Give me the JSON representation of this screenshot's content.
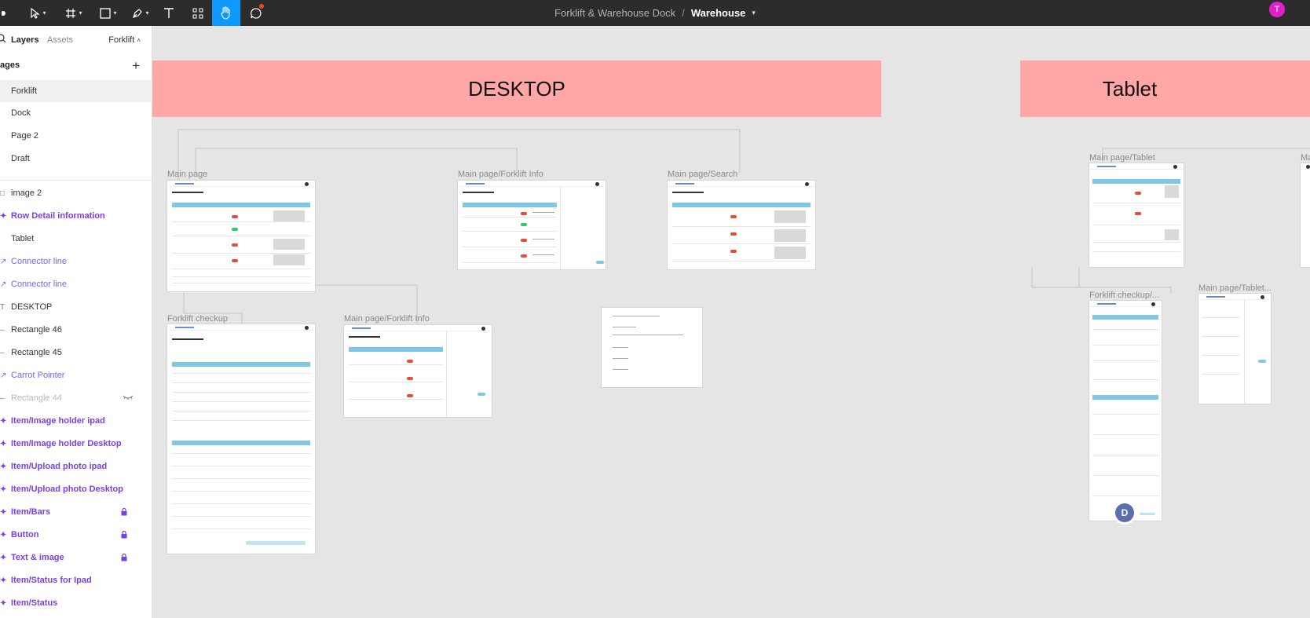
{
  "toolbar": {
    "menu_icon": "figma-menu-icon",
    "tools": [
      "move-tool",
      "frame-tool",
      "shape-tool",
      "pen-tool",
      "text-tool",
      "resources-tool",
      "hand-tool",
      "comment-tool"
    ],
    "active_tool": "hand-tool",
    "accent": "#0d99ff"
  },
  "title": {
    "file": "Forklift & Warehouse Dock",
    "separator": "/",
    "page": "Warehouse"
  },
  "user": {
    "initial": "T",
    "color": "#e020c8"
  },
  "panel": {
    "tabs": {
      "layers": "Layers",
      "assets": "Assets",
      "page": "Forklift"
    },
    "pages_header": "ages",
    "add_page": "+",
    "pages": [
      "Forklift",
      "Dock",
      "Page 2",
      "Draft"
    ],
    "selected_page": "Forklift",
    "layers": [
      {
        "name": "image 2",
        "kind": "image"
      },
      {
        "name": "Row Detail information",
        "kind": "component"
      },
      {
        "name": "Tablet",
        "kind": "text"
      },
      {
        "name": "Connector line",
        "kind": "connector"
      },
      {
        "name": "Connector line",
        "kind": "connector"
      },
      {
        "name": "DESKTOP",
        "kind": "text"
      },
      {
        "name": "Rectangle 46",
        "kind": "rect"
      },
      {
        "name": "Rectangle 45",
        "kind": "rect"
      },
      {
        "name": "Carrot Pointer",
        "kind": "connector"
      },
      {
        "name": "Rectangle 44",
        "kind": "hidden"
      },
      {
        "name": "Item/Image holder ipad",
        "kind": "component"
      },
      {
        "name": "Item/Image holder Desktop",
        "kind": "component"
      },
      {
        "name": "Item/Upload photo ipad",
        "kind": "component"
      },
      {
        "name": "Item/Upload photo Desktop",
        "kind": "component"
      },
      {
        "name": "Item/Bars",
        "kind": "component",
        "locked": true
      },
      {
        "name": "Button",
        "kind": "component",
        "locked": true
      },
      {
        "name": "Text & image",
        "kind": "component",
        "locked": true
      },
      {
        "name": "Item/Status for Ipad",
        "kind": "component"
      },
      {
        "name": "Item/Status",
        "kind": "component"
      }
    ]
  },
  "canvas": {
    "background": "#e5e5e5",
    "sections": [
      {
        "label": "DESKTOP",
        "color": "#ffa6a6"
      },
      {
        "label": "Tablet",
        "color": "#ffa6a6"
      }
    ],
    "frames": [
      {
        "label": "Main page"
      },
      {
        "label": "Main page/Forklift Info"
      },
      {
        "label": "Main page/Search"
      },
      {
        "label": "Forklift checkup"
      },
      {
        "label": "Main page/Forklift Info"
      },
      {
        "label": "Main page/Tablet"
      },
      {
        "label": "Forklift checkup/..."
      },
      {
        "label": "Main page/Tablet..."
      },
      {
        "label": "Ma"
      }
    ],
    "collaborator": {
      "initial": "D",
      "color": "#5b6fae"
    }
  }
}
